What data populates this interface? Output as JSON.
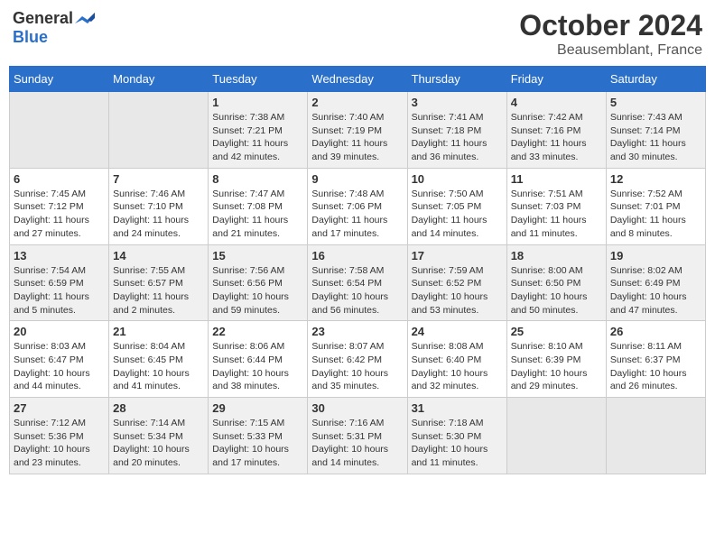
{
  "header": {
    "logo_general": "General",
    "logo_blue": "Blue",
    "month": "October 2024",
    "location": "Beausemblant, France"
  },
  "days_of_week": [
    "Sunday",
    "Monday",
    "Tuesday",
    "Wednesday",
    "Thursday",
    "Friday",
    "Saturday"
  ],
  "weeks": [
    [
      {
        "day": "",
        "info": ""
      },
      {
        "day": "",
        "info": ""
      },
      {
        "day": "1",
        "info": "Sunrise: 7:38 AM\nSunset: 7:21 PM\nDaylight: 11 hours and 42 minutes."
      },
      {
        "day": "2",
        "info": "Sunrise: 7:40 AM\nSunset: 7:19 PM\nDaylight: 11 hours and 39 minutes."
      },
      {
        "day": "3",
        "info": "Sunrise: 7:41 AM\nSunset: 7:18 PM\nDaylight: 11 hours and 36 minutes."
      },
      {
        "day": "4",
        "info": "Sunrise: 7:42 AM\nSunset: 7:16 PM\nDaylight: 11 hours and 33 minutes."
      },
      {
        "day": "5",
        "info": "Sunrise: 7:43 AM\nSunset: 7:14 PM\nDaylight: 11 hours and 30 minutes."
      }
    ],
    [
      {
        "day": "6",
        "info": "Sunrise: 7:45 AM\nSunset: 7:12 PM\nDaylight: 11 hours and 27 minutes."
      },
      {
        "day": "7",
        "info": "Sunrise: 7:46 AM\nSunset: 7:10 PM\nDaylight: 11 hours and 24 minutes."
      },
      {
        "day": "8",
        "info": "Sunrise: 7:47 AM\nSunset: 7:08 PM\nDaylight: 11 hours and 21 minutes."
      },
      {
        "day": "9",
        "info": "Sunrise: 7:48 AM\nSunset: 7:06 PM\nDaylight: 11 hours and 17 minutes."
      },
      {
        "day": "10",
        "info": "Sunrise: 7:50 AM\nSunset: 7:05 PM\nDaylight: 11 hours and 14 minutes."
      },
      {
        "day": "11",
        "info": "Sunrise: 7:51 AM\nSunset: 7:03 PM\nDaylight: 11 hours and 11 minutes."
      },
      {
        "day": "12",
        "info": "Sunrise: 7:52 AM\nSunset: 7:01 PM\nDaylight: 11 hours and 8 minutes."
      }
    ],
    [
      {
        "day": "13",
        "info": "Sunrise: 7:54 AM\nSunset: 6:59 PM\nDaylight: 11 hours and 5 minutes."
      },
      {
        "day": "14",
        "info": "Sunrise: 7:55 AM\nSunset: 6:57 PM\nDaylight: 11 hours and 2 minutes."
      },
      {
        "day": "15",
        "info": "Sunrise: 7:56 AM\nSunset: 6:56 PM\nDaylight: 10 hours and 59 minutes."
      },
      {
        "day": "16",
        "info": "Sunrise: 7:58 AM\nSunset: 6:54 PM\nDaylight: 10 hours and 56 minutes."
      },
      {
        "day": "17",
        "info": "Sunrise: 7:59 AM\nSunset: 6:52 PM\nDaylight: 10 hours and 53 minutes."
      },
      {
        "day": "18",
        "info": "Sunrise: 8:00 AM\nSunset: 6:50 PM\nDaylight: 10 hours and 50 minutes."
      },
      {
        "day": "19",
        "info": "Sunrise: 8:02 AM\nSunset: 6:49 PM\nDaylight: 10 hours and 47 minutes."
      }
    ],
    [
      {
        "day": "20",
        "info": "Sunrise: 8:03 AM\nSunset: 6:47 PM\nDaylight: 10 hours and 44 minutes."
      },
      {
        "day": "21",
        "info": "Sunrise: 8:04 AM\nSunset: 6:45 PM\nDaylight: 10 hours and 41 minutes."
      },
      {
        "day": "22",
        "info": "Sunrise: 8:06 AM\nSunset: 6:44 PM\nDaylight: 10 hours and 38 minutes."
      },
      {
        "day": "23",
        "info": "Sunrise: 8:07 AM\nSunset: 6:42 PM\nDaylight: 10 hours and 35 minutes."
      },
      {
        "day": "24",
        "info": "Sunrise: 8:08 AM\nSunset: 6:40 PM\nDaylight: 10 hours and 32 minutes."
      },
      {
        "day": "25",
        "info": "Sunrise: 8:10 AM\nSunset: 6:39 PM\nDaylight: 10 hours and 29 minutes."
      },
      {
        "day": "26",
        "info": "Sunrise: 8:11 AM\nSunset: 6:37 PM\nDaylight: 10 hours and 26 minutes."
      }
    ],
    [
      {
        "day": "27",
        "info": "Sunrise: 7:12 AM\nSunset: 5:36 PM\nDaylight: 10 hours and 23 minutes."
      },
      {
        "day": "28",
        "info": "Sunrise: 7:14 AM\nSunset: 5:34 PM\nDaylight: 10 hours and 20 minutes."
      },
      {
        "day": "29",
        "info": "Sunrise: 7:15 AM\nSunset: 5:33 PM\nDaylight: 10 hours and 17 minutes."
      },
      {
        "day": "30",
        "info": "Sunrise: 7:16 AM\nSunset: 5:31 PM\nDaylight: 10 hours and 14 minutes."
      },
      {
        "day": "31",
        "info": "Sunrise: 7:18 AM\nSunset: 5:30 PM\nDaylight: 10 hours and 11 minutes."
      },
      {
        "day": "",
        "info": ""
      },
      {
        "day": "",
        "info": ""
      }
    ]
  ]
}
